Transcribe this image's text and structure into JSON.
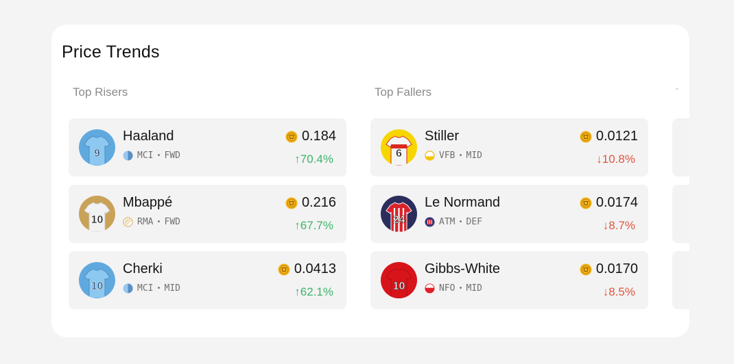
{
  "title": "Price Trends",
  "risers": {
    "heading": "Top Risers",
    "items": [
      {
        "name": "Haaland",
        "team": "MCI",
        "pos": "FWD",
        "price": "0.184",
        "change": "70.4%",
        "kit": "mci",
        "number": "9"
      },
      {
        "name": "Mbappé",
        "team": "RMA",
        "pos": "FWD",
        "price": "0.216",
        "change": "67.7%",
        "kit": "rma",
        "number": "10"
      },
      {
        "name": "Cherki",
        "team": "MCI",
        "pos": "MID",
        "price": "0.0413",
        "change": "62.1%",
        "kit": "mci",
        "number": "10"
      }
    ]
  },
  "fallers": {
    "heading": "Top Fallers",
    "items": [
      {
        "name": "Stiller",
        "team": "VFB",
        "pos": "MID",
        "price": "0.0121",
        "change": "10.8%",
        "kit": "vfb",
        "number": "6"
      },
      {
        "name": "Le Normand",
        "team": "ATM",
        "pos": "DEF",
        "price": "0.0174",
        "change": "8.7%",
        "kit": "atm",
        "number": "24"
      },
      {
        "name": "Gibbs-White",
        "team": "NFO",
        "pos": "MID",
        "price": "0.0170",
        "change": "8.5%",
        "kit": "nfo",
        "number": "10"
      }
    ]
  },
  "symbols": {
    "up_arrow": "↑",
    "down_arrow": "↓",
    "separator": "•",
    "third_column_marker": "-"
  },
  "colors": {
    "up": "#3cb56a",
    "down": "#e0553f",
    "coin": "#f2b31b",
    "card_bg": "#ffffff",
    "row_bg": "#f3f3f3",
    "page_bg": "#f4f4f4"
  },
  "icons": {
    "coin": "coin-icon",
    "team_badge": "team-badge-icon",
    "jersey": "jersey-avatar"
  }
}
